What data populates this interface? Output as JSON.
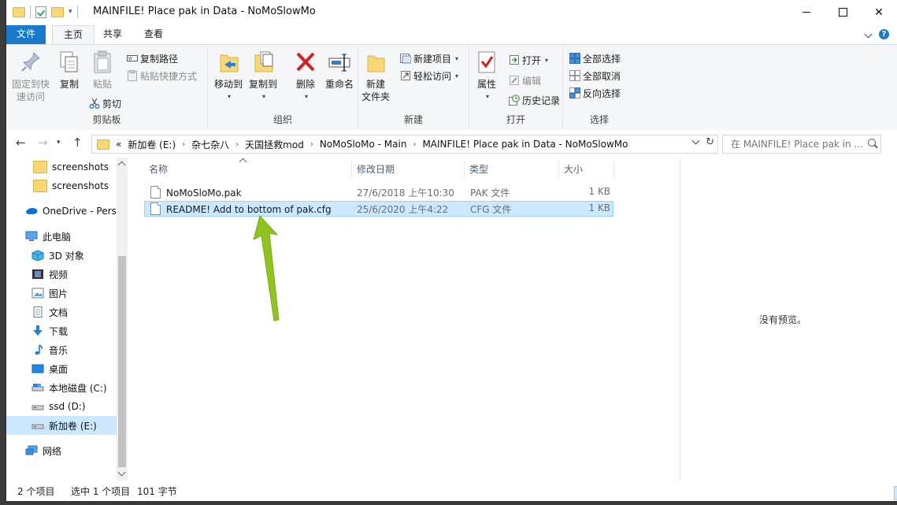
{
  "window": {
    "title": "MAINFILE! Place pak in Data - NoMoSlowMo"
  },
  "ribbon_tabs": [
    {
      "label": "文件"
    },
    {
      "label": "主页"
    },
    {
      "label": "共享"
    },
    {
      "label": "查看"
    }
  ],
  "ribbon": {
    "clipboard": {
      "pin": "固定到快",
      "pin2": "速访问",
      "copy": "复制",
      "paste": "粘贴",
      "copy_path": "复制路径",
      "paste_shortcut": "粘贴快捷方式",
      "cut": "剪切",
      "label": "剪贴板"
    },
    "organize": {
      "move_to": "移动到",
      "copy_to": "复制到",
      "delete": "删除",
      "rename": "重命名",
      "label": "组织"
    },
    "new": {
      "new_folder": "新建",
      "new_folder2": "文件夹",
      "new_item": "新建项目",
      "easy_access": "轻松访问",
      "label": "新建"
    },
    "open": {
      "properties": "属性",
      "open": "打开",
      "edit": "编辑",
      "history": "历史记录",
      "label": "打开"
    },
    "select": {
      "select_all": "全部选择",
      "select_none": "全部取消",
      "invert": "反向选择",
      "label": "选择"
    }
  },
  "address": {
    "overflow": "«",
    "crumbs": [
      "新加卷 (E:)",
      "杂七杂八",
      "天国拯救mod",
      "NoMoSloMo - Main",
      "MAINFILE! Place pak in Data - NoMoSlowMo"
    ]
  },
  "search": {
    "placeholder": "在 MAINFILE! Place pak in ..."
  },
  "nav": [
    {
      "label": "screenshots",
      "icon": "folder-icon"
    },
    {
      "label": "screenshots",
      "icon": "folder-icon"
    },
    {
      "label": "OneDrive - Personal",
      "icon": "cloud-icon"
    },
    {
      "label": "此电脑",
      "icon": "pc-icon"
    },
    {
      "label": "3D 对象",
      "icon": "cube-icon"
    },
    {
      "label": "视频",
      "icon": "video-icon"
    },
    {
      "label": "图片",
      "icon": "picture-icon"
    },
    {
      "label": "文档",
      "icon": "document-icon"
    },
    {
      "label": "下载",
      "icon": "download-icon"
    },
    {
      "label": "音乐",
      "icon": "music-icon"
    },
    {
      "label": "桌面",
      "icon": "desktop-icon"
    },
    {
      "label": "本地磁盘 (C:)",
      "icon": "drive-icon"
    },
    {
      "label": "ssd (D:)",
      "icon": "drive-icon"
    },
    {
      "label": "新加卷 (E:)",
      "icon": "drive-icon"
    },
    {
      "label": "网络",
      "icon": "network-icon"
    }
  ],
  "columns": {
    "name": "名称",
    "modified": "修改日期",
    "type": "类型",
    "size": "大小"
  },
  "files": [
    {
      "name": "NoMoSloMo.pak",
      "modified": "27/6/2018 上午10:30",
      "type": "PAK 文件",
      "size": "1 KB"
    },
    {
      "name": "README! Add to bottom of pak.cfg",
      "modified": "25/6/2020 上午4:22",
      "type": "CFG 文件",
      "size": "1 KB"
    }
  ],
  "preview": {
    "empty": "没有预览。"
  },
  "status": {
    "count": "2 个项目",
    "selected": "选中 1 个项目",
    "bytes": "101 字节"
  },
  "colors": {
    "accent": "#1979ca",
    "selection": "#cce8ff",
    "annotation_arrow": "#8fc31f"
  }
}
